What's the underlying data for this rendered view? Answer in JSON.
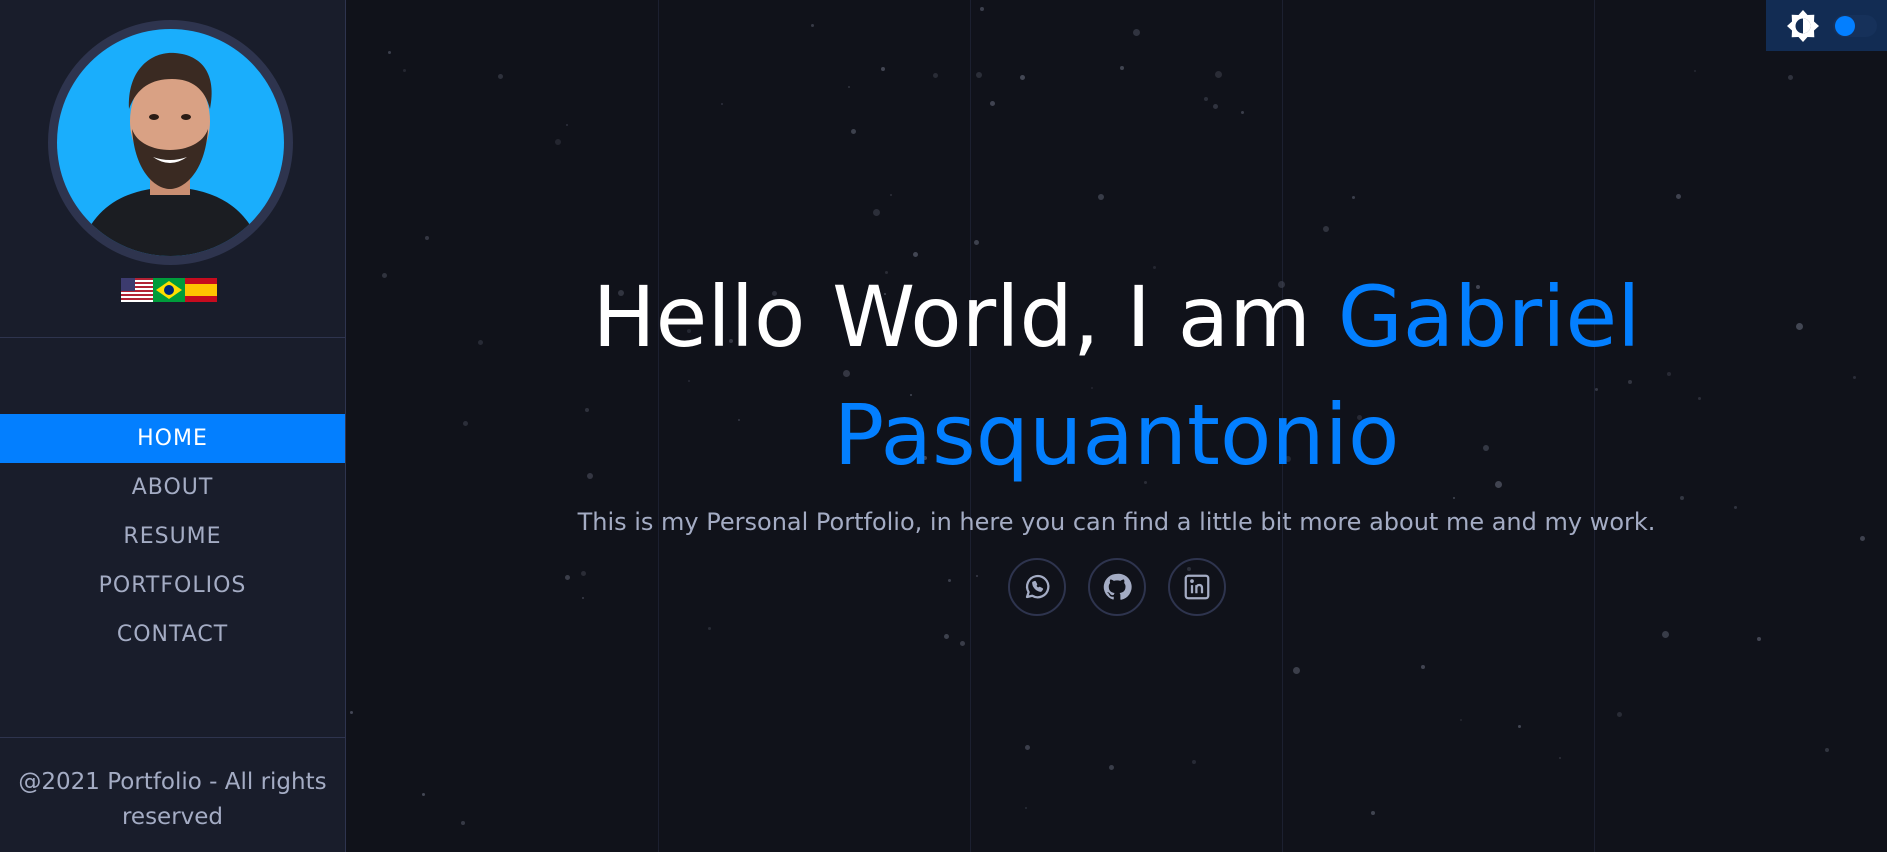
{
  "sidebar": {
    "profile_photo": "portrait-photo",
    "languages": [
      "us-flag-icon",
      "brazil-flag-icon",
      "spain-flag-icon"
    ],
    "nav": [
      {
        "label": "HOME",
        "active": true
      },
      {
        "label": "ABOUT",
        "active": false
      },
      {
        "label": "RESUME",
        "active": false
      },
      {
        "label": "PORTFOLIOS",
        "active": false
      },
      {
        "label": "CONTACT",
        "active": false
      }
    ],
    "footer": "@2021 Portfolio - All rights reserved"
  },
  "hero": {
    "greeting": "Hello World, I am ",
    "name": "Gabriel Pasquantonio",
    "subtitle": "This is my Personal Portfolio, in here you can find a little bit more about me and my work."
  },
  "social": [
    {
      "icon": "whatsapp-icon"
    },
    {
      "icon": "github-icon"
    },
    {
      "icon": "linkedin-icon"
    }
  ],
  "theme_toggle": {
    "icon": "brightness-icon",
    "state": "on"
  },
  "colors": {
    "accent": "#037fff",
    "sidebar_bg": "#191d2b",
    "main_bg": "#10121a",
    "text_muted": "#a4acc4",
    "border": "#2e344e"
  }
}
